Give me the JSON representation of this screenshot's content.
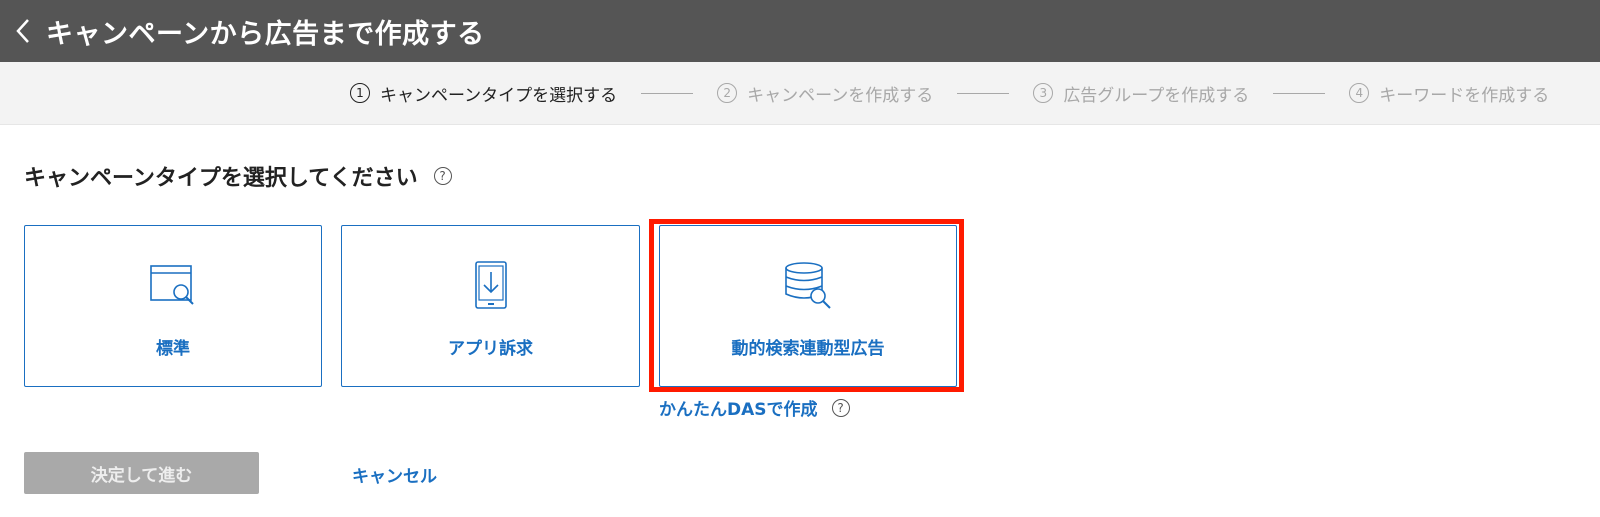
{
  "header": {
    "title": "キャンペーンから広告まで作成する"
  },
  "steps": [
    {
      "num": "1",
      "label": "キャンペーンタイプを選択する",
      "state": "active"
    },
    {
      "num": "2",
      "label": "キャンペーンを作成する",
      "state": "inactive"
    },
    {
      "num": "3",
      "label": "広告グループを作成する",
      "state": "inactive"
    },
    {
      "num": "4",
      "label": "キーワードを作成する",
      "state": "inactive"
    }
  ],
  "main": {
    "section_title": "キャンペーンタイプを選択してください",
    "help_glyph": "?",
    "cards": [
      {
        "label": "標準",
        "icon": "browser-search-icon"
      },
      {
        "label": "アプリ訴求",
        "icon": "tablet-download-icon"
      },
      {
        "label": "動的検索連動型広告",
        "icon": "database-search-icon",
        "highlighted": true
      }
    ],
    "easy_das_link": "かんたんDASで作成"
  },
  "footer": {
    "submit_label": "決定して進む",
    "submit_disabled": true,
    "cancel_label": "キャンセル"
  },
  "colors": {
    "header_bg": "#555555",
    "accent": "#1a6fc1",
    "highlight": "#ff1a00",
    "disabled_button": "#a9a9a9"
  }
}
